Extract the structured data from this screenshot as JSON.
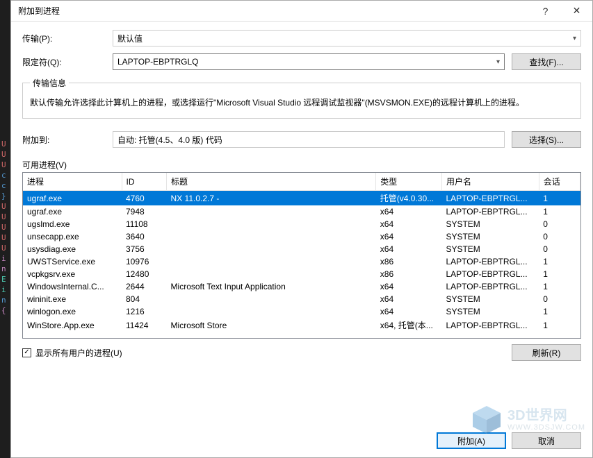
{
  "window": {
    "title": "附加到进程",
    "help_icon": "?",
    "close_icon": "✕"
  },
  "transport": {
    "label": "传输(P):",
    "value": "默认值"
  },
  "qualifier": {
    "label": "限定符(Q):",
    "value": "LAPTOP-EBPTRGLQ",
    "find_button": "查找(F)..."
  },
  "transport_info": {
    "legend": "传输信息",
    "text": "默认传输允许选择此计算机上的进程，或选择运行\"Microsoft Visual Studio 远程调试监视器\"(MSVSMON.EXE)的远程计算机上的进程。"
  },
  "attach_to": {
    "label": "附加到:",
    "value": "自动: 托管(4.5、4.0 版) 代码",
    "select_button": "选择(S)..."
  },
  "available": {
    "label": "可用进程(V)"
  },
  "columns": {
    "process": "进程",
    "id": "ID",
    "title": "标题",
    "type": "类型",
    "user": "用户名",
    "session": "会话"
  },
  "rows": [
    {
      "proc": "ugraf.exe",
      "id": "4760",
      "title": "NX 11.0.2.7 -",
      "type": "托管(v4.0.30...",
      "user": "LAPTOP-EBPTRGL...",
      "sess": "1",
      "selected": true
    },
    {
      "proc": "ugraf.exe",
      "id": "7948",
      "title": "",
      "type": "x64",
      "user": "LAPTOP-EBPTRGL...",
      "sess": "1"
    },
    {
      "proc": "ugslmd.exe",
      "id": "11108",
      "title": "",
      "type": "x64",
      "user": "SYSTEM",
      "sess": "0"
    },
    {
      "proc": "unsecapp.exe",
      "id": "3640",
      "title": "",
      "type": "x64",
      "user": "SYSTEM",
      "sess": "0"
    },
    {
      "proc": "usysdiag.exe",
      "id": "3756",
      "title": "",
      "type": "x64",
      "user": "SYSTEM",
      "sess": "0"
    },
    {
      "proc": "UWSTService.exe",
      "id": "10976",
      "title": "",
      "type": "x86",
      "user": "LAPTOP-EBPTRGL...",
      "sess": "1"
    },
    {
      "proc": "vcpkgsrv.exe",
      "id": "12480",
      "title": "",
      "type": "x86",
      "user": "LAPTOP-EBPTRGL...",
      "sess": "1"
    },
    {
      "proc": "WindowsInternal.C...",
      "id": "2644",
      "title": "Microsoft Text Input Application",
      "type": "x64",
      "user": "LAPTOP-EBPTRGL...",
      "sess": "1"
    },
    {
      "proc": "wininit.exe",
      "id": "804",
      "title": "",
      "type": "x64",
      "user": "SYSTEM",
      "sess": "0"
    },
    {
      "proc": "winlogon.exe",
      "id": "1216",
      "title": "",
      "type": "x64",
      "user": "SYSTEM",
      "sess": "1"
    },
    {
      "proc": "WinStore.App.exe",
      "id": "11424",
      "title": "Microsoft Store",
      "type": "x64, 托管(本...",
      "user": "LAPTOP-EBPTRGL...",
      "sess": "1"
    }
  ],
  "show_all": {
    "label": "显示所有用户的进程(U)",
    "checked": true
  },
  "refresh_button": "刷新(R)",
  "attach_button": "附加(A)",
  "cancel_button": "取消",
  "watermark": {
    "text": "3D世界网",
    "sub": "WWW.3DSJW.COM"
  }
}
